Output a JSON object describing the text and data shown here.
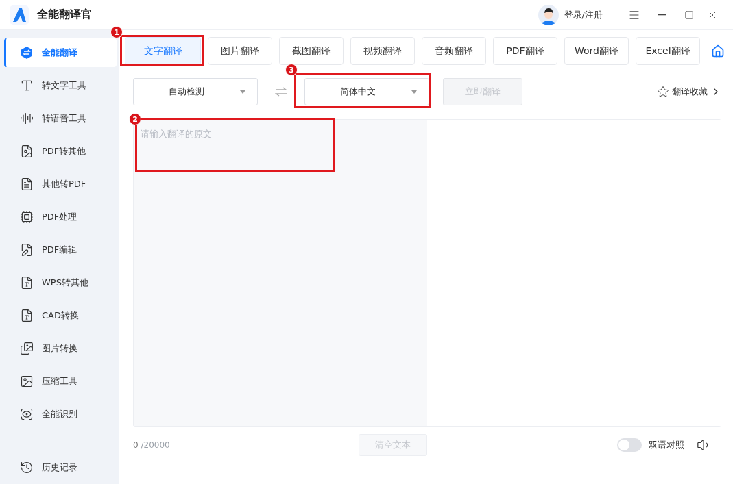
{
  "app": {
    "title": "全能翻译官",
    "login": "登录/注册"
  },
  "sidebar": {
    "items": [
      {
        "label": "全能翻译",
        "selected": true
      },
      {
        "label": "转文字工具",
        "selected": false
      },
      {
        "label": "转语音工具",
        "selected": false
      },
      {
        "label": "PDF转其他",
        "selected": false
      },
      {
        "label": "其他转PDF",
        "selected": false
      },
      {
        "label": "PDF处理",
        "selected": false
      },
      {
        "label": "PDF编辑",
        "selected": false
      },
      {
        "label": "WPS转其他",
        "selected": false
      },
      {
        "label": "CAD转换",
        "selected": false
      },
      {
        "label": "图片转换",
        "selected": false
      },
      {
        "label": "压缩工具",
        "selected": false
      },
      {
        "label": "全能识别",
        "selected": false
      }
    ],
    "footer_item": {
      "label": "历史记录"
    }
  },
  "tabs": [
    {
      "label": "文字翻译",
      "selected": true
    },
    {
      "label": "图片翻译",
      "selected": false
    },
    {
      "label": "截图翻译",
      "selected": false
    },
    {
      "label": "视频翻译",
      "selected": false
    },
    {
      "label": "音频翻译",
      "selected": false
    },
    {
      "label": "PDF翻译",
      "selected": false
    },
    {
      "label": "Word翻译",
      "selected": false
    },
    {
      "label": "Excel翻译",
      "selected": false
    }
  ],
  "source_language": "自动检测",
  "target_language": "简体中文",
  "translate_button": {
    "label": "立即翻译",
    "disabled": true
  },
  "favorites": "翻译收藏",
  "input": {
    "placeholder": "请输入翻译的原文"
  },
  "counter": {
    "count": "0",
    "limit": "/20000"
  },
  "clear_button": {
    "label": "清空文本",
    "disabled": true
  },
  "bilingual": {
    "label": "双语对照",
    "on": false
  },
  "annotations": [
    {
      "label": "1"
    },
    {
      "label": "2"
    },
    {
      "label": "3"
    }
  ]
}
